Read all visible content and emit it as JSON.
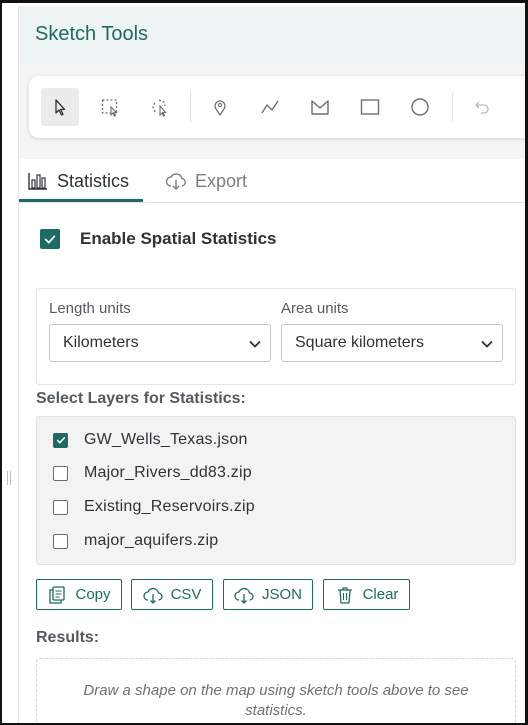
{
  "header": {
    "title": "Sketch Tools"
  },
  "toolbar": {
    "tools": [
      {
        "icon": "pointer-icon",
        "active": true
      },
      {
        "icon": "rectangle-select-icon",
        "active": false
      },
      {
        "icon": "lasso-select-icon",
        "active": false
      },
      {
        "icon": "point-icon",
        "active": false
      },
      {
        "icon": "polyline-icon",
        "active": false
      },
      {
        "icon": "polygon-icon",
        "active": false
      },
      {
        "icon": "rectangle-icon",
        "active": false
      },
      {
        "icon": "circle-icon",
        "active": false
      },
      {
        "icon": "undo-icon",
        "active": false
      }
    ]
  },
  "tabs": [
    {
      "label": "Statistics",
      "icon": "bar-chart-icon",
      "active": true
    },
    {
      "label": "Export",
      "icon": "cloud-download-icon",
      "active": false
    }
  ],
  "statistics": {
    "enable_label": "Enable Spatial Statistics",
    "enabled": true,
    "length_units_label": "Length units",
    "length_units_value": "Kilometers",
    "area_units_label": "Area units",
    "area_units_value": "Square kilometers",
    "layers_label": "Select Layers for Statistics:",
    "layers": [
      {
        "name": "GW_Wells_Texas.json",
        "checked": true
      },
      {
        "name": "Major_Rivers_dd83.zip",
        "checked": false
      },
      {
        "name": "Existing_Reservoirs.zip",
        "checked": false
      },
      {
        "name": "major_aquifers.zip",
        "checked": false
      }
    ],
    "actions": {
      "copy": "Copy",
      "csv": "CSV",
      "json": "JSON",
      "clear": "Clear"
    },
    "results_label": "Results:",
    "results_placeholder": "Draw a shape on the map using sketch tools above to see statistics."
  },
  "colors": {
    "accent": "#1e6b63",
    "header_bg": "#eef3f3"
  }
}
